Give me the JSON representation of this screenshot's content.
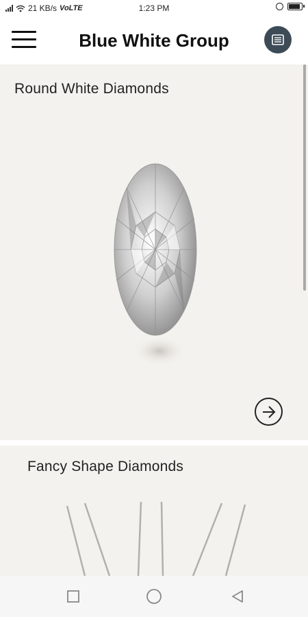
{
  "status_bar": {
    "network_speed": "21 KB/s",
    "network_type": "VoLTE",
    "time": "1:23 PM"
  },
  "app_bar": {
    "title": "Blue White Group",
    "menu_icon": "hamburger-icon",
    "catalog_icon": "list-icon"
  },
  "cards": [
    {
      "title": "Round White Diamonds",
      "icon": "arrow-right-circle-icon"
    },
    {
      "title": "Fancy Shape Diamonds"
    }
  ],
  "nav_bar": {
    "icons": [
      "recent-apps-icon",
      "home-icon",
      "back-icon"
    ]
  },
  "colors": {
    "background": "#f4f2ee",
    "app_bar": "#ffffff",
    "catalog_button": "#3d4b57"
  }
}
